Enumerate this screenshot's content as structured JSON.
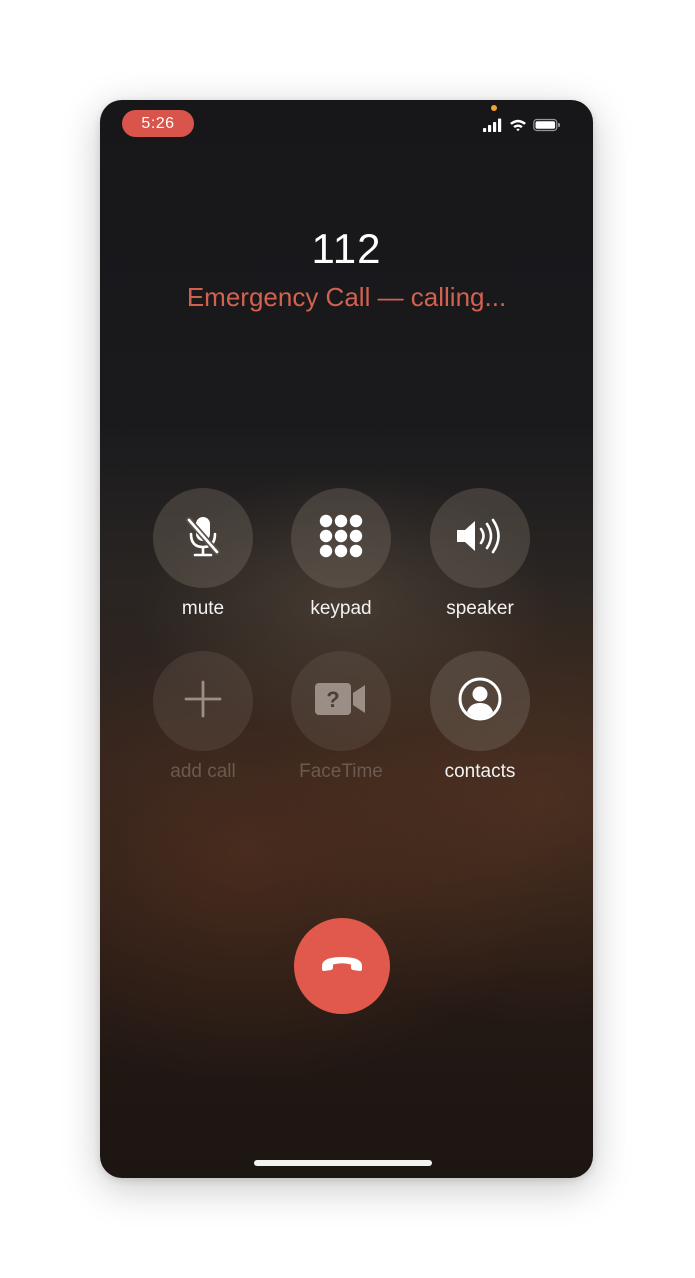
{
  "status_bar": {
    "time": "5:26",
    "signal_icon": "signal-bars-icon",
    "wifi_icon": "wifi-icon",
    "battery_icon": "battery-icon"
  },
  "call": {
    "number": "112",
    "status": "Emergency Call — calling..."
  },
  "controls": {
    "mute": {
      "label": "mute",
      "icon": "microphone-slash-icon"
    },
    "keypad": {
      "label": "keypad",
      "icon": "keypad-grid-icon"
    },
    "speaker": {
      "label": "speaker",
      "icon": "speaker-icon"
    },
    "add_call": {
      "label": "add call",
      "icon": "plus-icon",
      "enabled": false
    },
    "facetime": {
      "label": "FaceTime",
      "icon": "facetime-camera-icon",
      "enabled": false
    },
    "contacts": {
      "label": "contacts",
      "icon": "contact-person-icon"
    }
  },
  "end_call": {
    "icon": "phone-hangup-icon"
  },
  "colors": {
    "accent_red": "#e0594c",
    "status_text": "#d2614f",
    "time_pill": "#d9544a",
    "indicator_dot": "#f0a336"
  }
}
